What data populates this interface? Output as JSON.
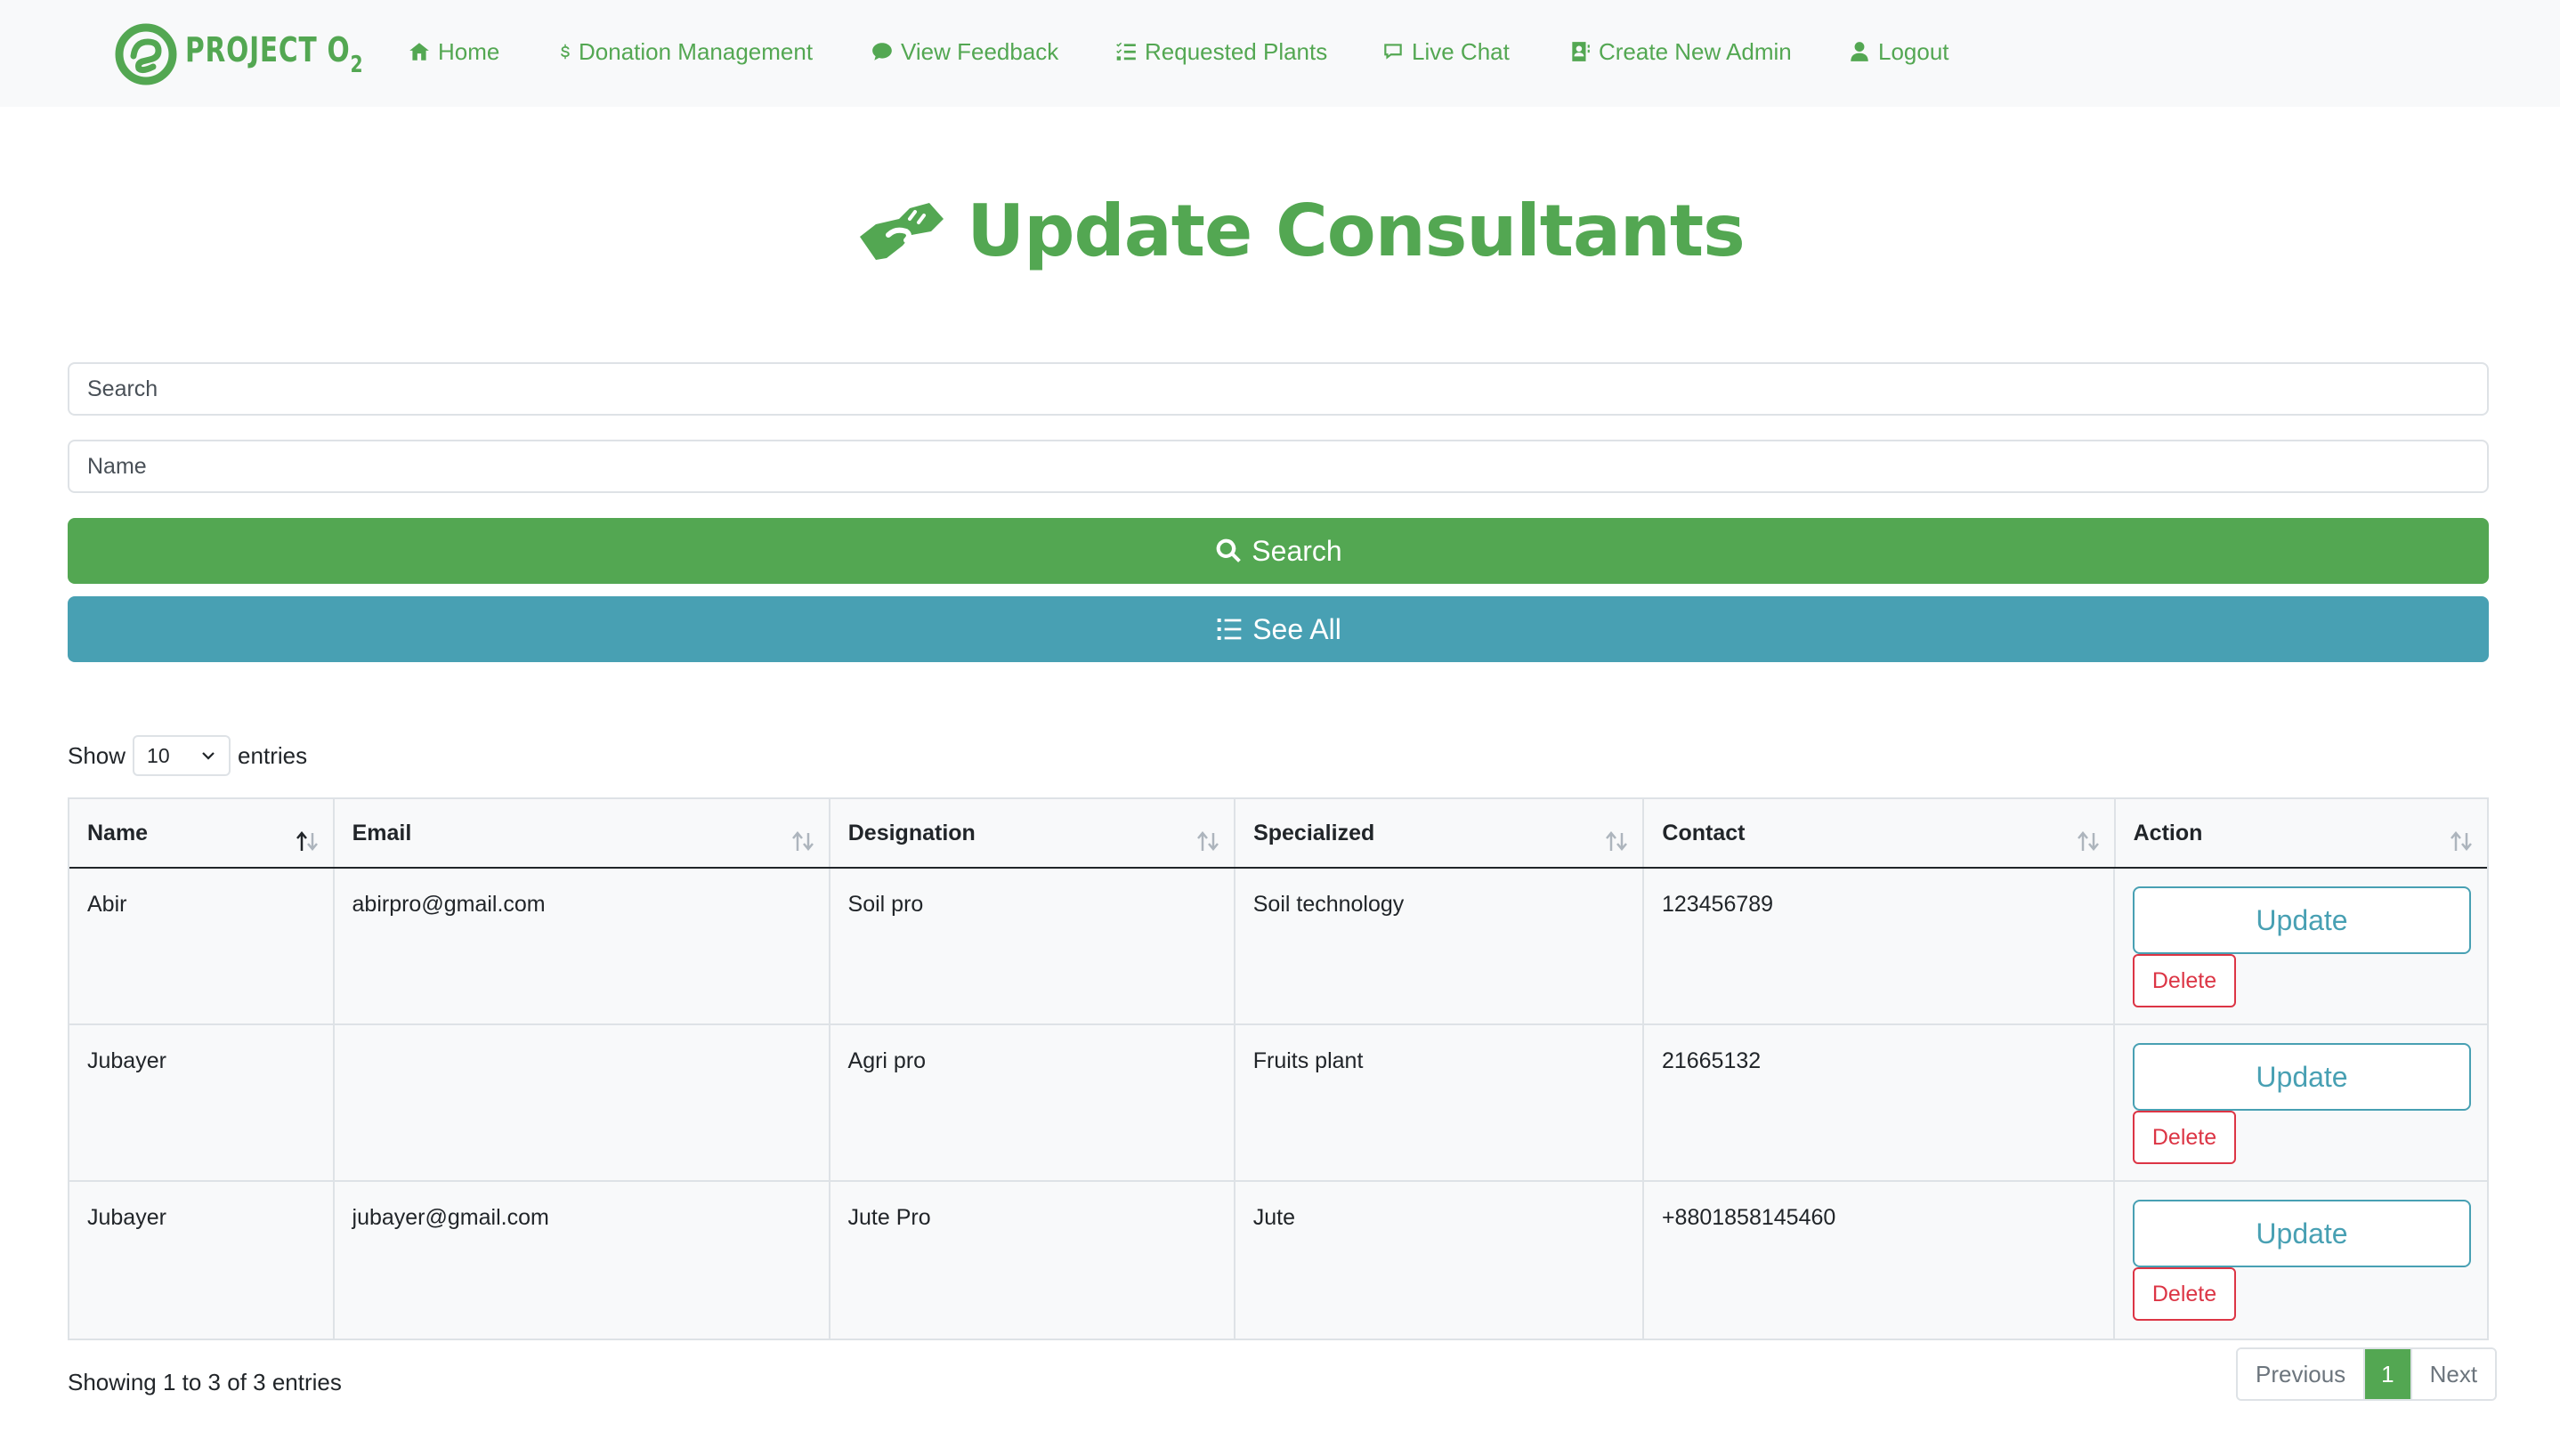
{
  "brand": {
    "name": "PROJECT O",
    "subscript": "2"
  },
  "nav": [
    {
      "label": "Home",
      "icon": "home-icon"
    },
    {
      "label": "Donation Management",
      "icon": "dollar-icon"
    },
    {
      "label": "View Feedback",
      "icon": "comment-icon"
    },
    {
      "label": "Requested Plants",
      "icon": "list-check-icon"
    },
    {
      "label": "Live Chat",
      "icon": "chat-icon"
    },
    {
      "label": "Create New Admin",
      "icon": "address-book-icon"
    },
    {
      "label": "Logout",
      "icon": "user-icon"
    }
  ],
  "page": {
    "title": "Update Consultants",
    "title_icon": "handshake-icon"
  },
  "form": {
    "search_placeholder": "Search",
    "name_placeholder": "Name",
    "search_button": "Search",
    "see_all_button": "See All"
  },
  "table_controls": {
    "show_label": "Show",
    "entries_value": "10",
    "entries_label": "entries"
  },
  "table": {
    "columns": [
      "Name",
      "Email",
      "Designation",
      "Specialized",
      "Contact",
      "Action"
    ],
    "rows": [
      {
        "name": "Abir",
        "email": "abirpro@gmail.com",
        "designation": "Soil pro",
        "specialized": "Soil technology",
        "contact": "123456789"
      },
      {
        "name": "Jubayer",
        "email": "",
        "designation": "Agri pro",
        "specialized": "Fruits plant",
        "contact": "21665132"
      },
      {
        "name": "Jubayer",
        "email": "jubayer@gmail.com",
        "designation": "Jute Pro",
        "specialized": "Jute",
        "contact": "+8801858145460"
      }
    ],
    "update_label": "Update",
    "delete_label": "Delete"
  },
  "footer": {
    "showing": "Showing 1 to 3 of 3 entries",
    "previous": "Previous",
    "current_page": "1",
    "next": "Next"
  },
  "colors": {
    "brand_green": "#53a752",
    "info_teal": "#48a0b3",
    "danger_red": "#dc3545"
  }
}
